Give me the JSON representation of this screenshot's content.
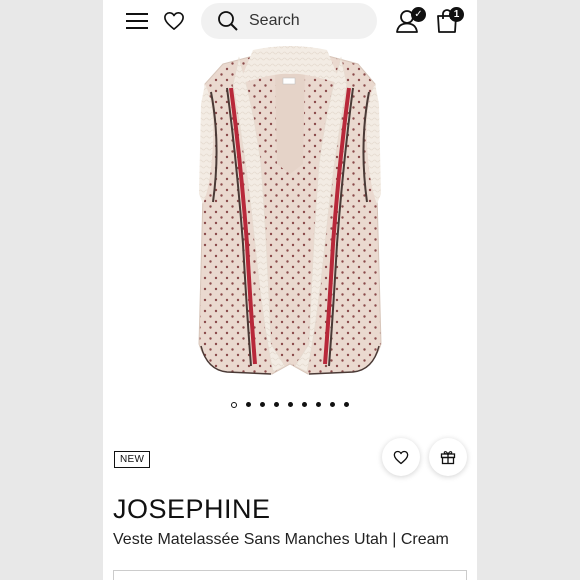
{
  "header": {
    "search_placeholder": "Search",
    "cart_count": "1",
    "account_badge": "✓",
    "icons": [
      "menu-icon",
      "heart-icon",
      "search-icon",
      "user-icon",
      "shopping-bag-icon"
    ]
  },
  "carousel": {
    "dot_count": 9,
    "active_index": 0
  },
  "product": {
    "badge": "NEW",
    "brand": "JOSEPHINE",
    "name": "Veste Matelassée Sans Manches Utah | Cream",
    "colors": {
      "body": "#ead9cf",
      "fur": "#f3ece4",
      "trim_red": "#b8283a",
      "trim_dark": "#4a3a36",
      "dots": "#8a4a4a"
    }
  }
}
